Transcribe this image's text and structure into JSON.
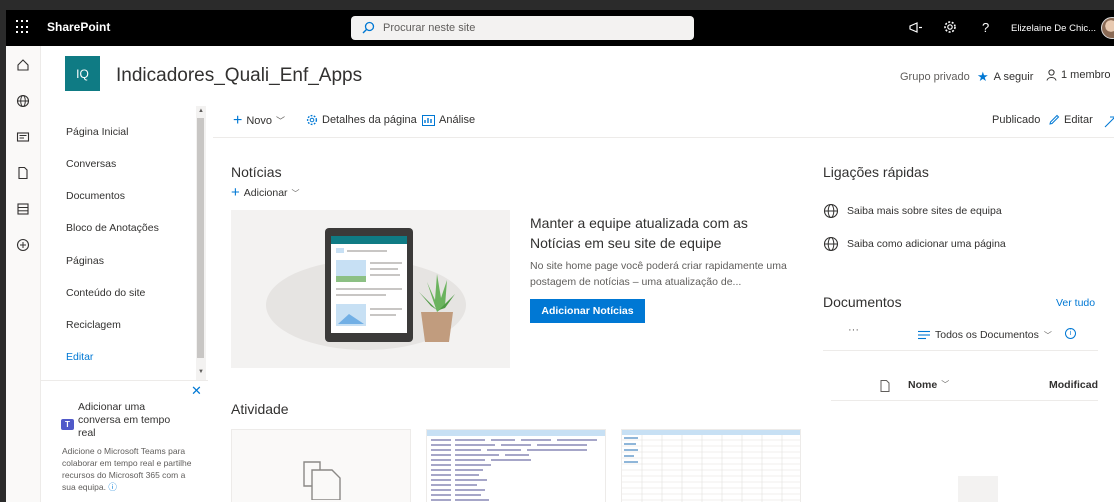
{
  "topbar": {
    "app_name": "SharePoint",
    "search_placeholder": "Procurar neste site",
    "user_name": "Elizelaine De Chic..."
  },
  "site": {
    "logo_initials": "IQ",
    "title": "Indicadores_Quali_Enf_Apps",
    "group_type": "Grupo privado",
    "follow_label": "A seguir",
    "members_label": "1 membro"
  },
  "nav": {
    "items": [
      {
        "label": "Página Inicial"
      },
      {
        "label": "Conversas"
      },
      {
        "label": "Documentos"
      },
      {
        "label": "Bloco de Anotações"
      },
      {
        "label": "Páginas"
      },
      {
        "label": "Conteúdo do site"
      },
      {
        "label": "Reciclagem"
      }
    ],
    "edit_label": "Editar"
  },
  "teams_card": {
    "title": "Adicionar uma conversa em tempo real",
    "body": "Adicione o Microsoft Teams para colaborar em tempo real e partilhe recursos do Microsoft 365 com a sua equipa."
  },
  "command_bar": {
    "new_label": "Novo",
    "details_label": "Detalhes da página",
    "analytics_label": "Análise",
    "published_label": "Publicado",
    "edit_label": "Editar"
  },
  "news": {
    "title": "Notícias",
    "add_label": "Adicionar",
    "headline": "Manter a equipe atualizada com as Notícias em seu site de equipe",
    "description": "No site home page você poderá criar rapidamente uma postagem de notícias – uma atualização de...",
    "button_label": "Adicionar Notícias"
  },
  "activity": {
    "title": "Atividade"
  },
  "quick_links": {
    "title": "Ligações rápidas",
    "items": [
      {
        "label": "Saiba mais sobre sites de equipa"
      },
      {
        "label": "Saiba como adicionar uma página"
      }
    ]
  },
  "documents": {
    "title": "Documentos",
    "see_all": "Ver tudo",
    "dots": "···",
    "view_label": "Todos os Documentos",
    "col_name": "Nome",
    "col_modified": "Modificad"
  },
  "colors": {
    "accent": "#0078d4",
    "site_logo": "#0f7b84",
    "topbar": "#000000"
  }
}
